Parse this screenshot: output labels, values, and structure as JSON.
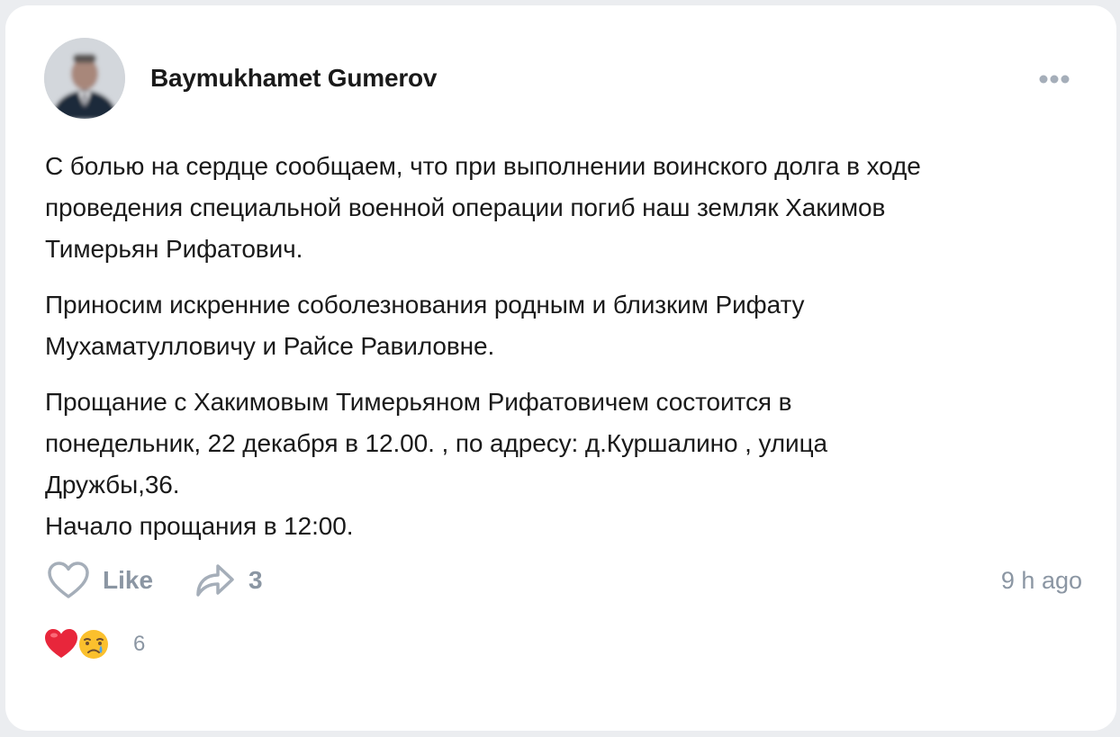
{
  "post": {
    "author_name": "Baymukhamet Gumerov",
    "paragraphs": [
      {
        "lines": [
          "С болью на сердце сообщаем, что при выполнении воинского долга в ходе",
          "проведения специальной военной операции погиб наш земляк Хакимов",
          "Тимерьян Рифатович."
        ]
      },
      {
        "lines": [
          "Приносим искренние соболезнования родным и близким Рифату",
          "Мухаматулловичу и Райсе Равиловне."
        ]
      },
      {
        "lines": [
          "Прощание с Хакимовым Тимерьяном Рифатовичем состоится в",
          "понедельник, 22 декабря в 12.00. , по адресу: д.Куршалино , улица",
          "Дружбы,36.",
          "Начало прощания в 12:00."
        ]
      }
    ],
    "icons": {
      "more": "more-horizontal-icon",
      "like": "heart-outline-icon",
      "share": "share-arrow-icon",
      "reaction_heart": "red-heart-emoji-icon",
      "reaction_cry": "crying-face-emoji-icon"
    }
  },
  "actions": {
    "like_label": "Like",
    "share_count": "3",
    "timestamp": "9 h ago"
  },
  "reactions": {
    "count": "6"
  },
  "colors": {
    "background": "#ebedf0",
    "card": "#ffffff",
    "text": "#1a1a1a",
    "muted": "#8b96a3"
  }
}
